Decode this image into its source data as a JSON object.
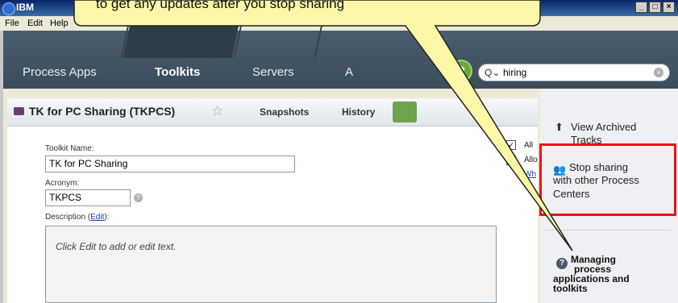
{
  "window": {
    "title": "IBM"
  },
  "menu": [
    "File",
    "Edit",
    "Help"
  ],
  "nav": {
    "tabs": [
      "Process Apps",
      "Toolkits",
      "Servers",
      "A"
    ],
    "active": "Toolkits",
    "help_label": "?",
    "search_value": "hiring"
  },
  "toolkit": {
    "title": "TK for PC Sharing (TKPCS)",
    "tabs": [
      "Snapshots",
      "History"
    ],
    "name_label": "Toolkit Name:",
    "name_value": "TK for PC Sharing",
    "acronym_label": "Acronym:",
    "acronym_value": "TKPCS",
    "description_label_pre": "Description (",
    "description_edit": "Edit",
    "description_label_post": "):",
    "description_placeholder": "Click Edit to add or edit text.",
    "options": [
      "All",
      "Allo",
      "Wh"
    ]
  },
  "right_panel": {
    "archived_line1": "View Archived",
    "archived_line2": "Tracks",
    "stop_line1": "Stop sharing",
    "stop_line2": "with other Process",
    "stop_line3": "Centers",
    "managing_line1": "Managing",
    "managing_line2": "process",
    "managing_line3": "applications and",
    "managing_line4": "toolkits"
  },
  "callout": {
    "text": "to get any updates after you stop sharing"
  },
  "colors": {
    "callout_fill": "#fbf7a7",
    "highlight_border": "#e11111",
    "nav_dark": "#3e4f5c",
    "help_green": "#6aa83b"
  }
}
